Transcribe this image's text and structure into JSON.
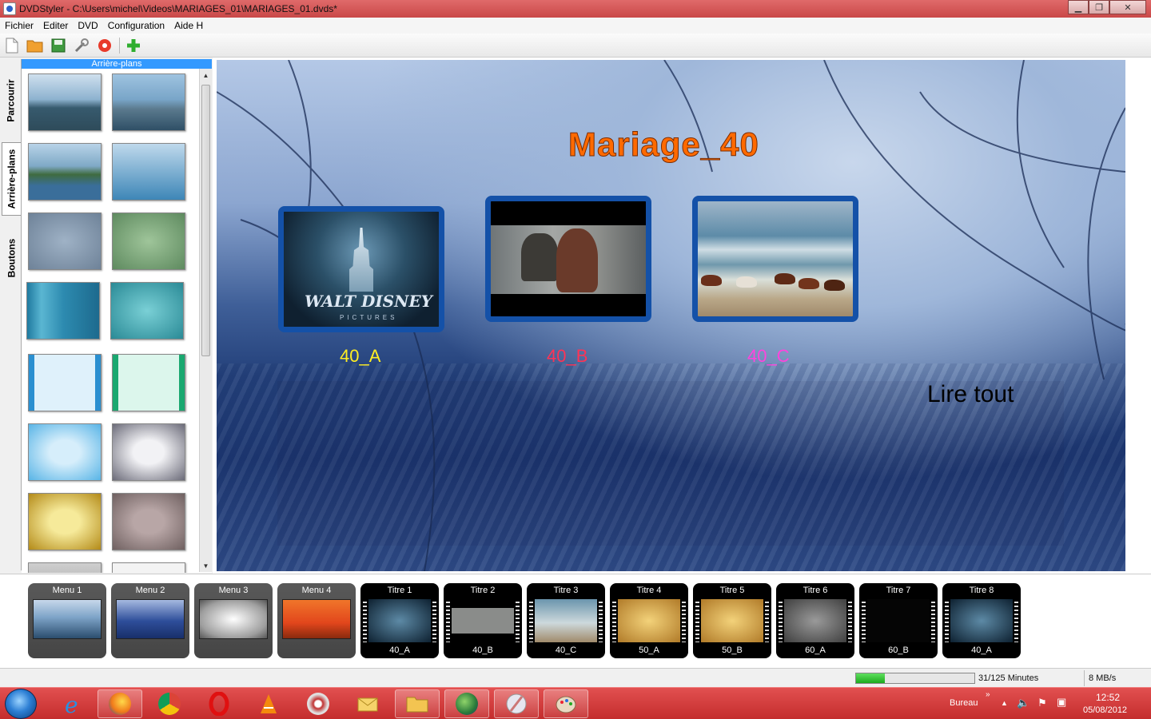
{
  "window": {
    "title": "DVDStyler - C:\\Users\\michel\\Videos\\MARIAGES_01\\MARIAGES_01.dvds*",
    "minimize": "▁",
    "restore": "❐",
    "close": "✕"
  },
  "menubar": [
    "Fichier",
    "Editer",
    "DVD",
    "Configuration",
    "Aide H"
  ],
  "toolbar": {
    "icons": [
      "new-icon",
      "open-icon",
      "save-icon",
      "settings-icon",
      "burn-icon",
      "add-icon"
    ]
  },
  "side_tabs": [
    "Parcourir",
    "Arrière-plans",
    "Boutons"
  ],
  "backgrounds_panel": {
    "header": "Arrière-plans"
  },
  "menu_preview": {
    "title": "Mariage_40",
    "buttons": [
      {
        "label": "40_A",
        "color": "#ffee22"
      },
      {
        "label": "40_B",
        "color": "#ff3355"
      },
      {
        "label": "40_C",
        "color": "#ff44dd"
      }
    ],
    "disney_text": "WALT DISNEY",
    "pictures_text": "PICTURES",
    "play_all": "Lire tout",
    "title_color": "#ff6a00",
    "frame_color": "#1451a8"
  },
  "filmstrip": {
    "menus": [
      "Menu 1",
      "Menu 2",
      "Menu 3",
      "Menu 4"
    ],
    "titles": [
      {
        "label": "Titre 1",
        "sub": "40_A"
      },
      {
        "label": "Titre 2",
        "sub": "40_B"
      },
      {
        "label": "Titre 3",
        "sub": "40_C"
      },
      {
        "label": "Titre 4",
        "sub": "50_A"
      },
      {
        "label": "Titre 5",
        "sub": "50_B"
      },
      {
        "label": "Titre 6",
        "sub": "60_A"
      },
      {
        "label": "Titre 7",
        "sub": "60_B"
      },
      {
        "label": "Titre 8",
        "sub": "40_A"
      }
    ]
  },
  "status": {
    "duration": "31/125 Minutes",
    "rate": "8 MB/s",
    "progress_fraction": 0.24
  },
  "taskbar": {
    "bureau": "Bureau",
    "time": "12:52",
    "date": "05/08/2012"
  }
}
